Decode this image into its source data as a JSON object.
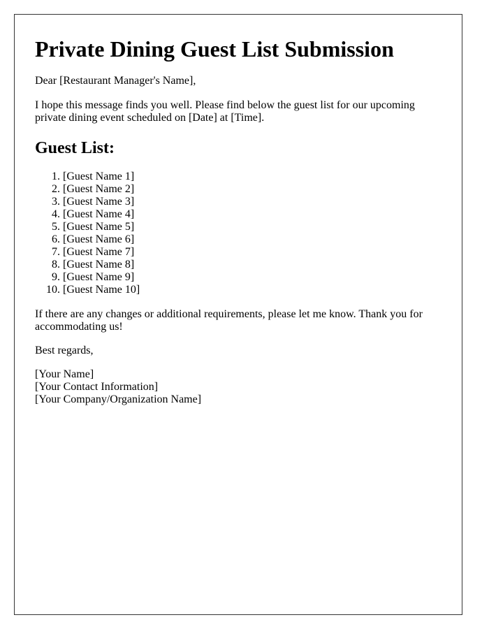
{
  "document": {
    "title": "Private Dining Guest List Submission",
    "greeting": "Dear [Restaurant Manager's Name],",
    "intro": "I hope this message finds you well. Please find below the guest list for our upcoming private dining event scheduled on [Date] at [Time].",
    "guest_list_heading": "Guest List:",
    "guests": [
      "[Guest Name 1]",
      "[Guest Name 2]",
      "[Guest Name 3]",
      "[Guest Name 4]",
      "[Guest Name 5]",
      "[Guest Name 6]",
      "[Guest Name 7]",
      "[Guest Name 8]",
      "[Guest Name 9]",
      "[Guest Name 10]"
    ],
    "closing": "If there are any changes or additional requirements, please let me know. Thank you for accommodating us!",
    "regards": "Best regards,",
    "signature": {
      "name": "[Your Name]",
      "contact": "[Your Contact Information]",
      "company": "[Your Company/Organization Name]"
    }
  }
}
